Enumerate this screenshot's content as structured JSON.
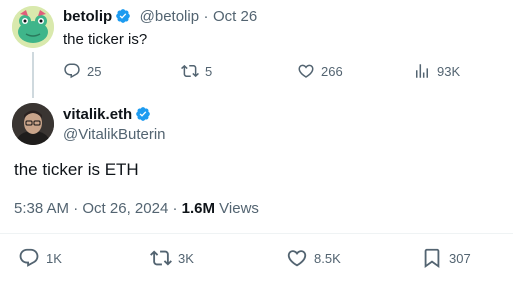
{
  "reply_to": {
    "display_name": "betolip",
    "handle": "@betolip",
    "date": "Oct 26",
    "text": "the ticker is?",
    "metrics": {
      "replies": "25",
      "retweets": "5",
      "likes": "266",
      "views": "93K"
    }
  },
  "tweet": {
    "display_name": "vitalik.eth",
    "handle": "@VitalikButerin",
    "text": "the ticker is ETH",
    "time": "5:38 AM",
    "date": "Oct 26, 2024",
    "views_count": "1.6M",
    "views_label": "Views",
    "metrics": {
      "replies": "1K",
      "retweets": "3K",
      "likes": "8.5K",
      "bookmarks": "307"
    }
  },
  "separator_dot": "·",
  "colors": {
    "verified": "#1d9bf0",
    "text": "#0f1419",
    "muted": "#536471"
  }
}
